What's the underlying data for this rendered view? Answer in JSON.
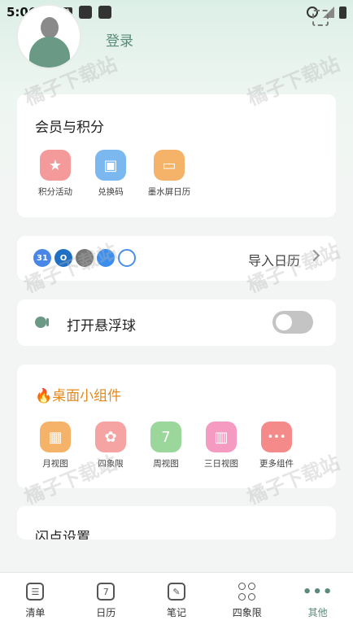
{
  "status": {
    "time": "5:06"
  },
  "header": {
    "login": "登录"
  },
  "membership": {
    "title": "会员与积分",
    "items": [
      {
        "label": "积分活动",
        "color": "#f59a9a",
        "glyph": "★"
      },
      {
        "label": "兑换码",
        "color": "#7ab8ef",
        "glyph": "▣"
      },
      {
        "label": "墨水屏日历",
        "color": "#f5b36a",
        "glyph": "▭"
      }
    ]
  },
  "import": {
    "label": "导入日历",
    "logos": [
      "31",
      "O",
      "",
      "",
      ""
    ]
  },
  "floatball": {
    "label": "打开悬浮球",
    "enabled": false
  },
  "widgets": {
    "title": "桌面小组件",
    "items": [
      {
        "label": "月视图",
        "color": "#f5b36a",
        "glyph": "▦"
      },
      {
        "label": "四象限",
        "color": "#f5a3a3",
        "glyph": "✿"
      },
      {
        "label": "周视图",
        "color": "#9bd69b",
        "glyph": "7"
      },
      {
        "label": "三日视图",
        "color": "#f59ac0",
        "glyph": "▥"
      },
      {
        "label": "更多组件",
        "color": "#f58a8a",
        "glyph": "•••"
      }
    ]
  },
  "flash": {
    "title": "闪点设置"
  },
  "watermark": "橘子下载站",
  "nav": [
    {
      "label": "清单"
    },
    {
      "label": "日历"
    },
    {
      "label": "笔记"
    },
    {
      "label": "四象限"
    },
    {
      "label": "其他"
    }
  ]
}
